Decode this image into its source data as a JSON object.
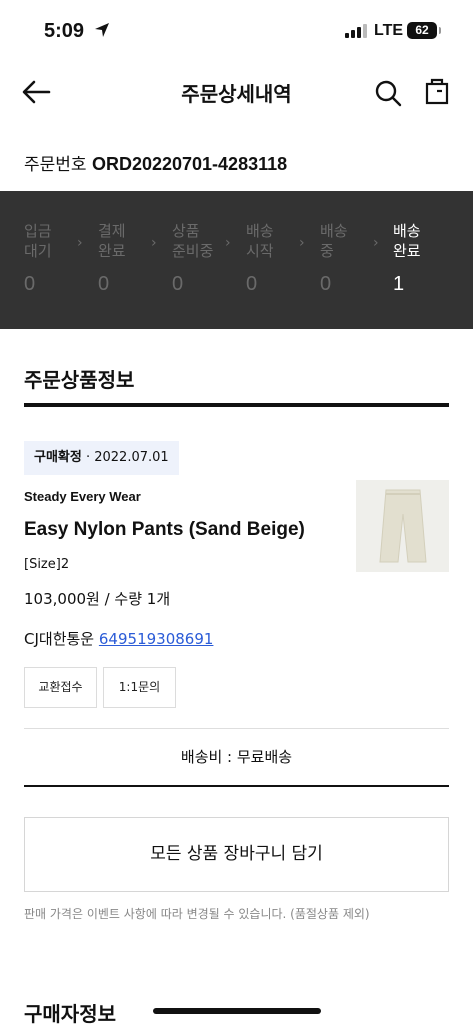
{
  "status_bar": {
    "time": "5:09",
    "network": "LTE",
    "battery": "62"
  },
  "header": {
    "title": "주문상세내역"
  },
  "order": {
    "label": "주문번호",
    "number": "ORD20220701-4283118"
  },
  "progress": {
    "steps": [
      {
        "label": "입금\n대기",
        "count": "0",
        "active": false
      },
      {
        "label": "결제\n완료",
        "count": "0",
        "active": false
      },
      {
        "label": "상품\n준비중",
        "count": "0",
        "active": false
      },
      {
        "label": "배송\n시작",
        "count": "0",
        "active": false
      },
      {
        "label": "배송\n중",
        "count": "0",
        "active": false
      },
      {
        "label": "배송\n완료",
        "count": "1",
        "active": true
      }
    ]
  },
  "product_section": {
    "title": "주문상품정보"
  },
  "item": {
    "status": "구매확정",
    "date": "· 2022.07.01",
    "brand": "Steady Every Wear",
    "name": "Easy Nylon Pants (Sand Beige)",
    "option": "[Size]2",
    "price_qty": "103,000원 / 수량 1개",
    "courier": "CJ대한통운",
    "tracking_no": "649519308691",
    "exchange_label": "교환접수",
    "inquiry_label": "1:1문의"
  },
  "shipping_fee": "배송비 : 무료배송",
  "cart_button": "모든 상품 장바구니 담기",
  "notice": "판매 가격은 이벤트 사항에 따라 변경될 수 있습니다. (품절상품 제외)",
  "buyer_section": {
    "title": "구매자정보"
  },
  "colors": {
    "progress_bg": "#333333",
    "link": "#2a5bd7",
    "badge_bg": "#eef2fb"
  }
}
